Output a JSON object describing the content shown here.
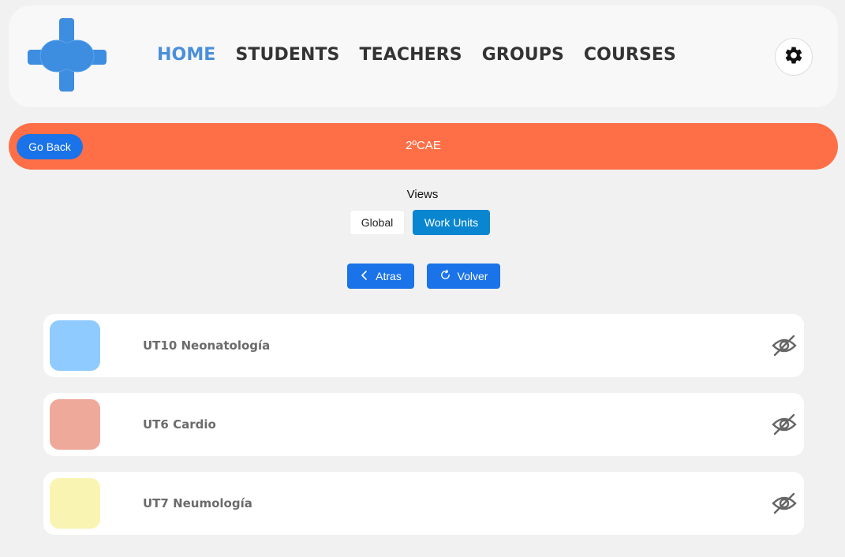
{
  "nav": {
    "links": [
      "HOME",
      "STUDENTS",
      "TEACHERS",
      "GROUPS",
      "COURSES"
    ],
    "active": "HOME",
    "logo_icon": "plus-heart-logo",
    "settings_icon": "gear-icon",
    "active_color": "#4a8fd9"
  },
  "banner": {
    "back_label": "Go Back",
    "title": "2ºCAE",
    "color": "#ff6f47"
  },
  "views": {
    "label": "Views",
    "options": [
      "Global",
      "Work Units"
    ],
    "selected": "Work Units"
  },
  "actions": {
    "back_label": "Atras",
    "back_icon": "chevron-left-icon",
    "reload_label": "Volver",
    "reload_icon": "refresh-icon"
  },
  "units": [
    {
      "name": "UT10 Neonatología",
      "color": "#8fcbff",
      "icon": "eye-slash-icon"
    },
    {
      "name": "UT6 Cardio",
      "color": "#eea99b",
      "icon": "eye-slash-icon"
    },
    {
      "name": "UT7 Neumología",
      "color": "#f9f4b2",
      "icon": "eye-slash-icon"
    }
  ]
}
